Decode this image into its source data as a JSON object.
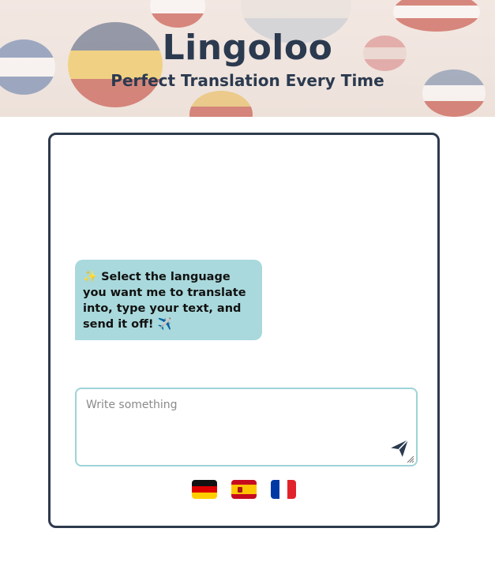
{
  "header": {
    "title": "Lingoloo",
    "subtitle": "Perfect Translation Every Time"
  },
  "chat": {
    "messages": [
      {
        "sender": "bot",
        "text": "✨ Select the language you want me to translate into, type your text, and send it off! ✈️"
      }
    ]
  },
  "composer": {
    "placeholder": "Write something",
    "send_icon": "paper-plane-icon"
  },
  "languages": [
    {
      "name": "German",
      "icon": "flag-germany-icon"
    },
    {
      "name": "Spanish",
      "icon": "flag-spain-icon"
    },
    {
      "name": "French",
      "icon": "flag-france-icon"
    }
  ],
  "colors": {
    "primary_text": "#2b3a4f",
    "card_border": "#2e3a4d",
    "bubble_bg": "#a9d9dc",
    "input_border": "#9ed3d8"
  }
}
